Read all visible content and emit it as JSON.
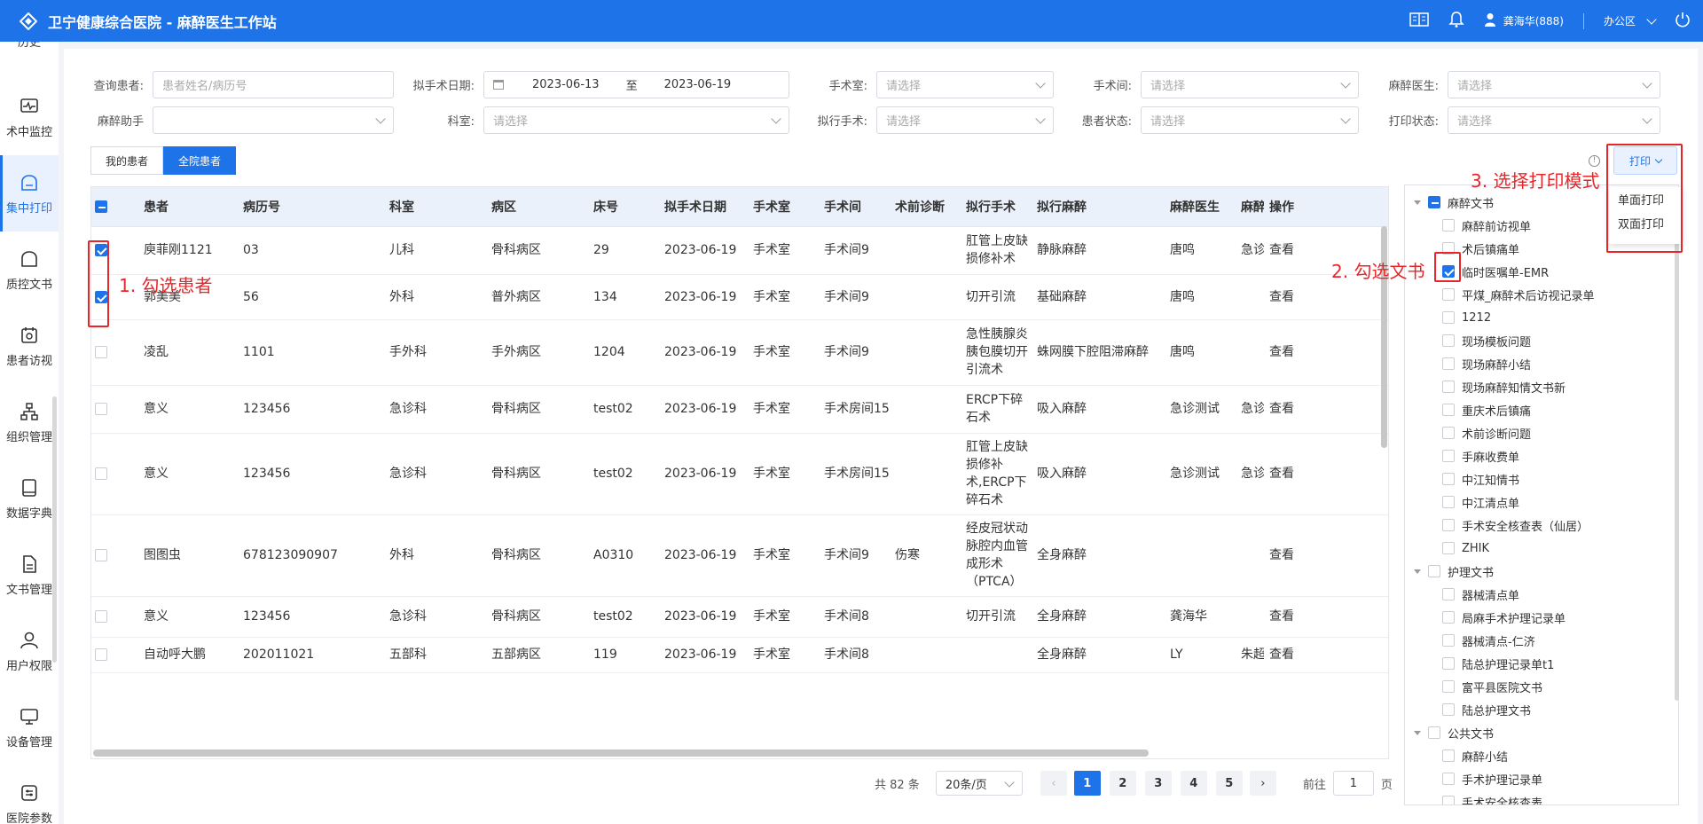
{
  "app": {
    "title": "卫宁健康综合医院 - 麻醉医生工作站",
    "user": "龚海华(888)",
    "office": "办公区"
  },
  "sidebar": [
    {
      "label": "历史",
      "icon": "history-icon"
    },
    {
      "label": "术中监控",
      "icon": "monitor-icon"
    },
    {
      "label": "集中打印",
      "icon": "print-icon",
      "active": true
    },
    {
      "label": "质控文书",
      "icon": "document-icon"
    },
    {
      "label": "患者访视",
      "icon": "calendar-icon"
    },
    {
      "label": "组织管理",
      "icon": "org-icon"
    },
    {
      "label": "数据字典",
      "icon": "book-icon"
    },
    {
      "label": "文书管理",
      "icon": "file-icon"
    },
    {
      "label": "用户权限",
      "icon": "user-icon"
    },
    {
      "label": "设备管理",
      "icon": "device-icon"
    },
    {
      "label": "医院参数",
      "icon": "settings-icon"
    }
  ],
  "filters": {
    "patient_label": "查询患者:",
    "patient_placeholder": "患者姓名/病历号",
    "date_label": "拟手术日期:",
    "date_from": "2023-06-13",
    "date_sep": "至",
    "date_to": "2023-06-19",
    "or_label": "手术室:",
    "or_placeholder": "请选择",
    "room_label": "手术间:",
    "room_placeholder": "请选择",
    "doctor_label": "麻醉医生:",
    "doctor_placeholder": "请选择",
    "assistant_label": "麻醉助手",
    "assistant_value": "",
    "dept_label": "科室:",
    "dept_placeholder": "请选择",
    "surgery_label": "拟行手术:",
    "surgery_placeholder": "请选择",
    "status_label": "患者状态:",
    "status_placeholder": "请选择",
    "print_status_label": "打印状态:",
    "print_status_placeholder": "请选择"
  },
  "tabs": {
    "mine": "我的患者",
    "all": "全院患者"
  },
  "table": {
    "headers": [
      "患者",
      "病历号",
      "科室",
      "病区",
      "床号",
      "拟手术日期",
      "手术室",
      "手术间",
      "术前诊断",
      "拟行手术",
      "拟行麻醉",
      "麻醉医生",
      "麻醉",
      "操作"
    ],
    "rows": [
      {
        "checked": true,
        "cells": [
          "庾菲刚1121",
          "03",
          "儿科",
          "骨科病区",
          "29",
          "2023-06-19",
          "手术室",
          "手术间9",
          "",
          "肛管上皮缺损修补术",
          "静脉麻醉",
          "唐鸣",
          "急诊",
          "查看"
        ]
      },
      {
        "checked": true,
        "cells": [
          "郭美美",
          "56",
          "外科",
          "普外病区",
          "134",
          "2023-06-19",
          "手术室",
          "手术间9",
          "",
          "切开引流",
          "基础麻醉",
          "唐鸣",
          "",
          "查看"
        ]
      },
      {
        "checked": false,
        "cells": [
          "凌乱",
          "1101",
          "手外科",
          "手外病区",
          "1204",
          "2023-06-19",
          "手术室",
          "手术间9",
          "",
          "急性胰腺炎胰包膜切开引流术",
          "蛛网膜下腔阻滞麻醉",
          "唐鸣",
          "",
          "查看"
        ]
      },
      {
        "checked": false,
        "cells": [
          "意义",
          "123456",
          "急诊科",
          "骨科病区",
          "test02",
          "2023-06-19",
          "手术室",
          "手术房间15",
          "",
          "ERCP下碎石术",
          "吸入麻醉",
          "急诊测试",
          "急诊",
          "查看"
        ]
      },
      {
        "checked": false,
        "cells": [
          "意义",
          "123456",
          "急诊科",
          "骨科病区",
          "test02",
          "2023-06-19",
          "手术室",
          "手术房间15",
          "",
          "肛管上皮缺损修补术,ERCP下碎石术",
          "吸入麻醉",
          "急诊测试",
          "急诊",
          "查看"
        ]
      },
      {
        "checked": false,
        "cells": [
          "图图虫",
          "678123090907",
          "外科",
          "骨科病区",
          "A0310",
          "2023-06-19",
          "手术室",
          "手术间9",
          "伤寒",
          "经皮冠状动脉腔内血管成形术（PTCA）",
          "全身麻醉",
          "",
          "",
          "查看"
        ]
      },
      {
        "checked": false,
        "cells": [
          "意义",
          "123456",
          "急诊科",
          "骨科病区",
          "test02",
          "2023-06-19",
          "手术室",
          "手术间8",
          "",
          "切开引流",
          "全身麻醉",
          "龚海华",
          "",
          "查看"
        ]
      },
      {
        "checked": false,
        "cells": [
          "自动呼大鹏",
          "202011021",
          "五部科",
          "五部病区",
          "119",
          "2023-06-19",
          "手术室",
          "手术间8",
          "",
          "",
          "全身麻醉",
          "LY",
          "朱超",
          "查看"
        ]
      }
    ]
  },
  "pager": {
    "total": "共 82 条",
    "page_size": "20条/页",
    "pages": [
      "1",
      "2",
      "3",
      "4",
      "5"
    ],
    "goto_label": "前往",
    "goto_value": "1",
    "page_suffix": "页"
  },
  "tree": {
    "groups": [
      {
        "name": "麻醉文书",
        "state": "indeterminate",
        "items": [
          {
            "name": "麻醉前访视单",
            "checked": false
          },
          {
            "name": "术后镇痛单",
            "checked": false
          },
          {
            "name": "临时医嘱单-EMR",
            "checked": true
          },
          {
            "name": "平煤_麻醉术后访视记录单",
            "checked": false
          },
          {
            "name": "1212",
            "checked": false
          },
          {
            "name": "现场模板问题",
            "checked": false
          },
          {
            "name": "现场麻醉小结",
            "checked": false
          },
          {
            "name": "现场麻醉知情文书新",
            "checked": false
          },
          {
            "name": "重庆术后镇痛",
            "checked": false
          },
          {
            "name": "术前诊断问题",
            "checked": false
          },
          {
            "name": "手麻收费单",
            "checked": false
          },
          {
            "name": "中江知情书",
            "checked": false
          },
          {
            "name": "中江清点单",
            "checked": false
          },
          {
            "name": "手术安全核查表（仙居）",
            "checked": false
          },
          {
            "name": "ZHIK",
            "checked": false
          }
        ]
      },
      {
        "name": "护理文书",
        "state": "unchecked",
        "items": [
          {
            "name": "器械清点单",
            "checked": false
          },
          {
            "name": "局麻手术护理记录单",
            "checked": false
          },
          {
            "name": "器械清点-仁济",
            "checked": false
          },
          {
            "name": "陆总护理记录单t1",
            "checked": false
          },
          {
            "name": "富平县医院文书",
            "checked": false
          },
          {
            "name": "陆总护理文书",
            "checked": false
          }
        ]
      },
      {
        "name": "公共文书",
        "state": "unchecked",
        "items": [
          {
            "name": "麻醉小结",
            "checked": false
          },
          {
            "name": "手术护理记录单",
            "checked": false
          },
          {
            "name": "手术安全核查表",
            "checked": false
          }
        ]
      }
    ]
  },
  "print": {
    "button": "打印",
    "options": [
      "单面打印",
      "双面打印"
    ]
  },
  "annotations": {
    "step1": "1. 勾选患者",
    "step2": "2. 勾选文书",
    "step3": "3. 选择打印模式"
  },
  "colors": {
    "primary": "#1e73e8",
    "annotation": "#e8262a"
  }
}
